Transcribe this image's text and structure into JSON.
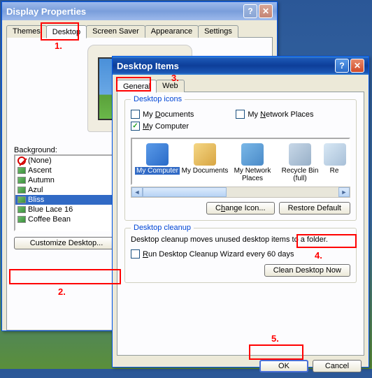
{
  "window1": {
    "title": "Display Properties",
    "tabs": [
      "Themes",
      "Desktop",
      "Screen Saver",
      "Appearance",
      "Settings"
    ],
    "active_tab_index": 1,
    "background_label": "Background:",
    "bg_list": [
      "(None)",
      "Ascent",
      "Autumn",
      "Azul",
      "Bliss",
      "Blue Lace 16",
      "Coffee Bean"
    ],
    "bg_selected_index": 4,
    "customize_btn": "Customize Desktop..."
  },
  "window2": {
    "title": "Desktop Items",
    "tabs": [
      "General",
      "Web"
    ],
    "active_tab_index": 0,
    "group_icons": "Desktop icons",
    "chk": {
      "my_documents": {
        "label": "My Documents",
        "checked": false
      },
      "my_network": {
        "label": "My Network Places",
        "checked": false
      },
      "my_computer": {
        "label": "My Computer",
        "checked": true
      }
    },
    "icons": [
      {
        "name": "My Computer"
      },
      {
        "name": "My Documents"
      },
      {
        "name": "My Network Places"
      },
      {
        "name": "Recycle Bin (full)"
      },
      {
        "name": "Re"
      }
    ],
    "icon_selected_index": 0,
    "change_icon_btn": "Change Icon...",
    "restore_default_btn": "Restore Default",
    "group_cleanup": "Desktop cleanup",
    "cleanup_desc": "Desktop cleanup moves unused desktop items to a folder.",
    "chk_wizard": {
      "label": "Run Desktop Cleanup Wizard every 60 days",
      "checked": false
    },
    "clean_btn": "Clean Desktop Now",
    "ok_btn": "OK",
    "cancel_btn": "Cancel"
  },
  "annotations": {
    "n1": "1.",
    "n2": "2.",
    "n3": "3.",
    "n4": "4.",
    "n5": "5."
  }
}
